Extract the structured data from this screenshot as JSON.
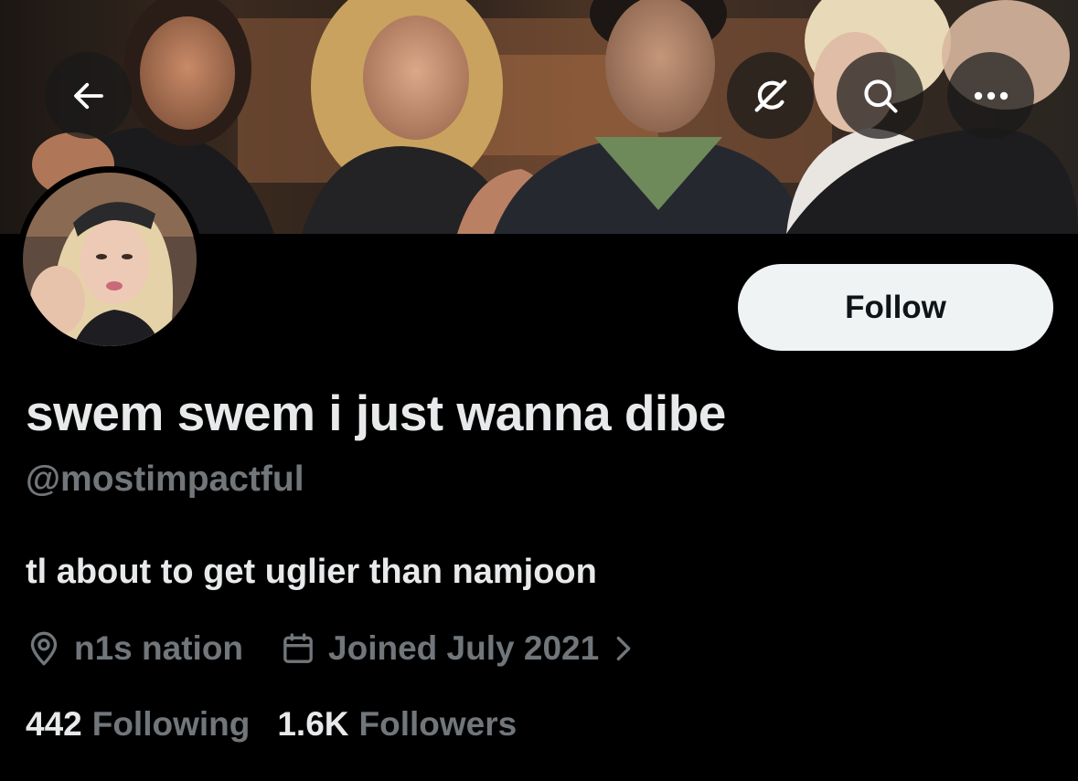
{
  "header": {
    "back_icon": "arrow-left-icon",
    "grok_icon": "grok-slash-icon",
    "search_icon": "search-icon",
    "more_icon": "more-horizontal-icon"
  },
  "profile": {
    "display_name": "swem swem i just wanna dibe",
    "handle": "@mostimpactful",
    "bio": "tl about to get uglier than namjoon",
    "location": "n1s nation",
    "joined": "Joined July 2021"
  },
  "actions": {
    "follow_label": "Follow"
  },
  "stats": {
    "following_count": "442",
    "following_label": "Following",
    "followers_count": "1.6K",
    "followers_label": "Followers"
  },
  "colors": {
    "background": "#000000",
    "primary_text": "#e7e9ea",
    "secondary_text": "#71767b",
    "follow_button_bg": "#eff3f4",
    "follow_button_text": "#0f1419"
  }
}
